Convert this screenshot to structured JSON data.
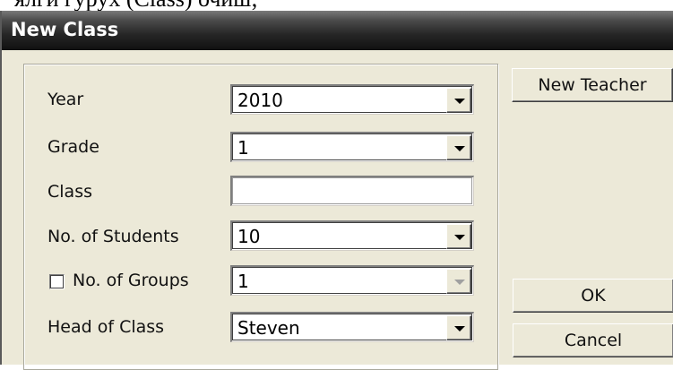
{
  "background_text": "ялги гурух (Class) очиш;",
  "window": {
    "title": "New Class"
  },
  "form": {
    "year": {
      "label": "Year",
      "value": "2010"
    },
    "grade": {
      "label": "Grade",
      "value": "1"
    },
    "class": {
      "label": "Class",
      "value": ""
    },
    "students": {
      "label": "No. of Students",
      "value": "10"
    },
    "groups": {
      "label": "No. of Groups",
      "value": "1",
      "checked": false,
      "enabled": false
    },
    "head": {
      "label": "Head of Class",
      "value": "Steven"
    }
  },
  "buttons": {
    "new_teacher": "New Teacher",
    "ok": "OK",
    "cancel": "Cancel"
  },
  "icons": {
    "dropdown": "chevron-down-icon",
    "checkbox": "checkbox-unchecked"
  }
}
